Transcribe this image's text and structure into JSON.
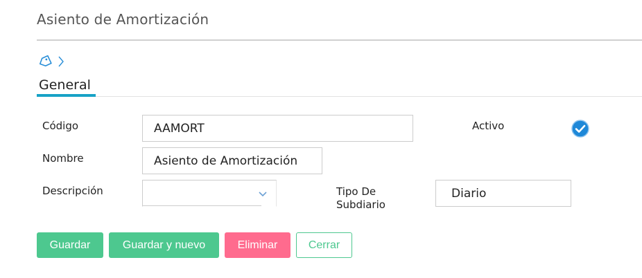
{
  "page": {
    "title": "Asiento de Amortización"
  },
  "tabs": [
    {
      "label": "General",
      "active": true
    }
  ],
  "icons": {
    "tag": "tag-icon",
    "chevron": "chevron-right-icon",
    "dropdown": "chevron-down-icon",
    "check": "check-circle-icon"
  },
  "form": {
    "codigo": {
      "label": "Código",
      "value": "AAMORT"
    },
    "activo": {
      "label": "Activo",
      "checked": true
    },
    "nombre": {
      "label": "Nombre",
      "value": "Asiento de Amortización"
    },
    "descripcion": {
      "label": "Descripción",
      "value": ""
    },
    "tipo_subdiario": {
      "label_line1": "Tipo De",
      "label_line2": "Subdiario",
      "value": "Diario"
    }
  },
  "buttons": {
    "guardar": "Guardar",
    "guardar_nuevo": "Guardar y nuevo",
    "eliminar": "Eliminar",
    "cerrar": "Cerrar"
  },
  "colors": {
    "accent": "#17a2c6",
    "green": "#4dc88f",
    "red": "#ff6b8e",
    "check": "#1e88d8"
  }
}
